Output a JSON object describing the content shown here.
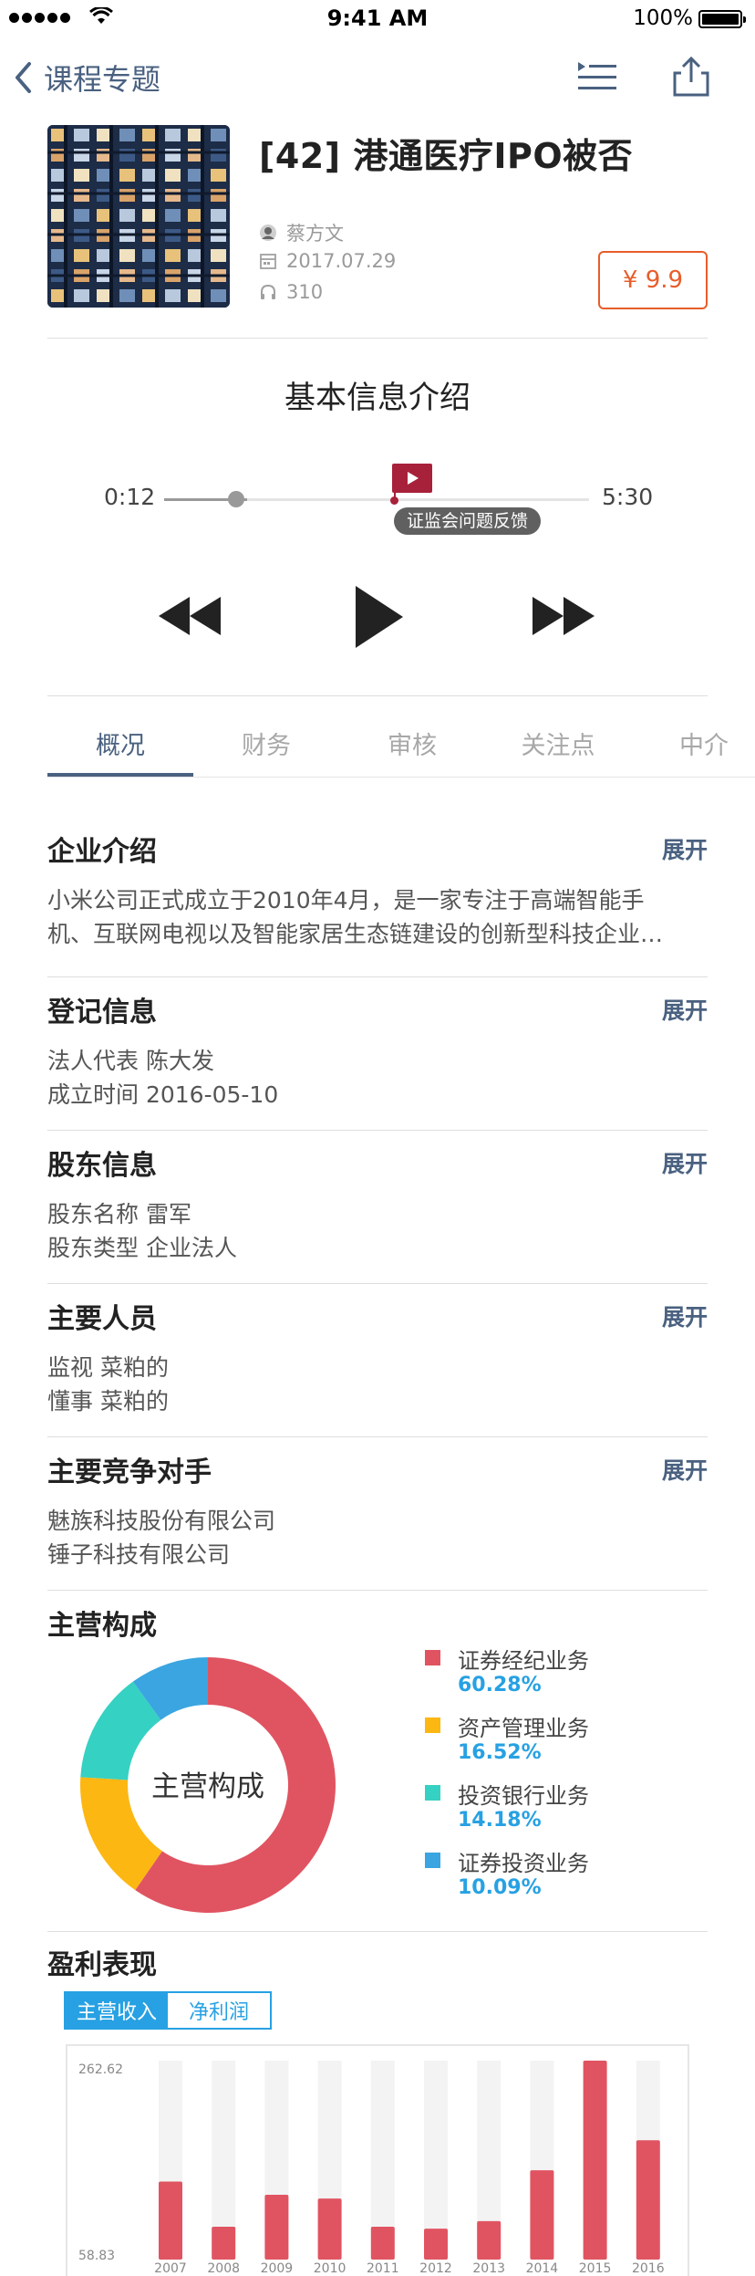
{
  "status_bar": {
    "time": "9:41 AM",
    "battery": "100%"
  },
  "nav": {
    "back_label": "课程专题"
  },
  "course": {
    "title": "[42] 港通医疗IPO被否",
    "author": "蔡方文",
    "date": "2017.07.29",
    "listens": "310",
    "price": "¥ 9.9"
  },
  "intro_heading": "基本信息介绍",
  "player": {
    "current_time": "0:12",
    "total_time": "5:30",
    "progress": 0.036,
    "marker_position": 0.54,
    "marker_label": "证监会问题反馈"
  },
  "tabs": [
    {
      "label": "概况",
      "active": true
    },
    {
      "label": "财务",
      "active": false
    },
    {
      "label": "审核",
      "active": false
    },
    {
      "label": "关注点",
      "active": false
    },
    {
      "label": "中介",
      "active": false
    }
  ],
  "expand_label": "展开",
  "sections": {
    "company": {
      "title": "企业介绍",
      "lines": [
        "小米公司正式成立于2010年4月，是一家专注于高端智能手",
        "机、互联网电视以及智能家居生态链建设的创新型科技企业…"
      ]
    },
    "registration": {
      "title": "登记信息",
      "lines": [
        "法人代表 陈大发",
        "成立时间 2016-05-10"
      ]
    },
    "shareholders": {
      "title": "股东信息",
      "lines": [
        "股东名称 雷军",
        "股东类型 企业法人"
      ]
    },
    "people": {
      "title": "主要人员",
      "lines": [
        "监视 菜粕的",
        "懂事 菜粕的"
      ]
    },
    "competitors": {
      "title": "主要竞争对手",
      "lines": [
        "魅族科技股份有限公司",
        "锤子科技有限公司"
      ]
    }
  },
  "business": {
    "title": "主营构成",
    "center_label": "主营构成",
    "items": [
      {
        "name": "证券经纪业务",
        "pct": "60.28%",
        "value": 60.28,
        "color": "#e05461"
      },
      {
        "name": "资产管理业务",
        "pct": "16.52%",
        "value": 16.52,
        "color": "#fcb712"
      },
      {
        "name": "投资银行业务",
        "pct": "14.18%",
        "value": 14.18,
        "color": "#35d1c3"
      },
      {
        "name": "证券投资业务",
        "pct": "10.09%",
        "value": 10.09,
        "color": "#3aa5e0"
      }
    ]
  },
  "profit": {
    "title": "盈利表现",
    "toggle": [
      "主营收入",
      "净利润"
    ]
  },
  "chart_data": {
    "type": "bar",
    "categories": [
      "2007",
      "2008",
      "2009",
      "2010",
      "2011",
      "2012",
      "2013",
      "2014",
      "2015",
      "2016"
    ],
    "values": [
      134,
      86,
      120,
      116,
      86,
      84,
      92,
      146,
      262.62,
      178
    ],
    "y_tick_labels": [
      "262.62",
      "58.83"
    ],
    "ylim": [
      58.83,
      262.62
    ],
    "bar_color": "#e05461",
    "track_color": "#f3f3f3",
    "grid": false
  }
}
